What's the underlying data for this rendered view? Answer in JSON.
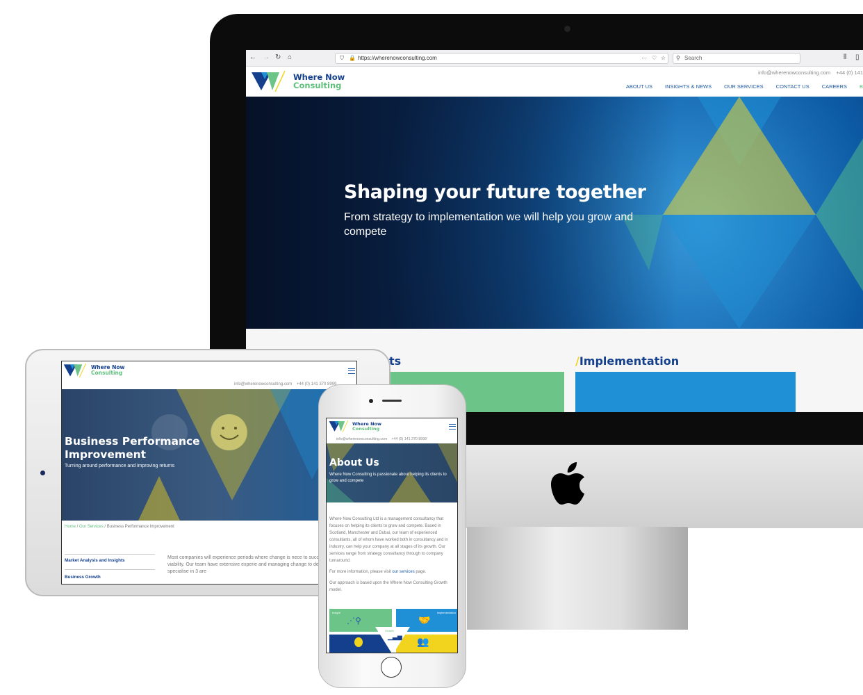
{
  "browser": {
    "url": "https://wherenowconsulting.com",
    "search_placeholder": "Search"
  },
  "brand": {
    "line1": "Where Now",
    "line2": "Consulting",
    "colors": {
      "navy": "#133f8c",
      "green": "#5fbf7b",
      "yellow": "#f2d41f",
      "blue": "#1f8fd6"
    }
  },
  "contact": {
    "email": "info@wherenowconsulting.com",
    "phone_desktop": "+44 (0) 141",
    "phone": "+44 (0) 141 370 8999"
  },
  "nav": [
    "ABOUT US",
    "INSIGHTS & NEWS",
    "OUR SERVICES",
    "CONTACT US",
    "CAREERS",
    "B"
  ],
  "desktop": {
    "hero_title": "Shaping your future together",
    "hero_subtitle": "From strategy to implementation we will help you grow and compete",
    "section_partial": "ts",
    "section_title": "Implementation",
    "slash": "/"
  },
  "tablet": {
    "hero_title": "Business Performance Improvement",
    "hero_subtitle": "Turning around performance and improving returns",
    "breadcrumb": {
      "home": "Home",
      "sep": " / ",
      "services": "Our Services",
      "current": "Business Performance Improvement"
    },
    "sidebar": [
      "Market Analysis and Insights",
      "Business Growth"
    ],
    "body": "Most companies will experience periods where change is nece to success or future viability. Our team have extensive experie and managing change to deliver results. We specialise in 3 are"
  },
  "phone": {
    "hero_title": "About Us",
    "hero_subtitle": "Where Now Consulting is passionate about helping its clients to grow and compete",
    "para1": "Where Now Consulting Ltd is a management consultancy that focuses on helping its clients to grow and compete. Based in Scotland, Manchester and Dubai, our team of experienced consultants, all of whom have worked both in consultancy and in industry, can help your company at all stages of its growth. Our services range from strategy consultancy through to company turnaround.",
    "para2_pre": "For more information, please visit ",
    "para2_link": "our services",
    "para2_post": " page.",
    "para3": "Our approach is based upon the Where Now Consulting Growth model.",
    "model": {
      "insight": "Insight",
      "implementation": "Implementation",
      "growth": "Growth"
    }
  }
}
